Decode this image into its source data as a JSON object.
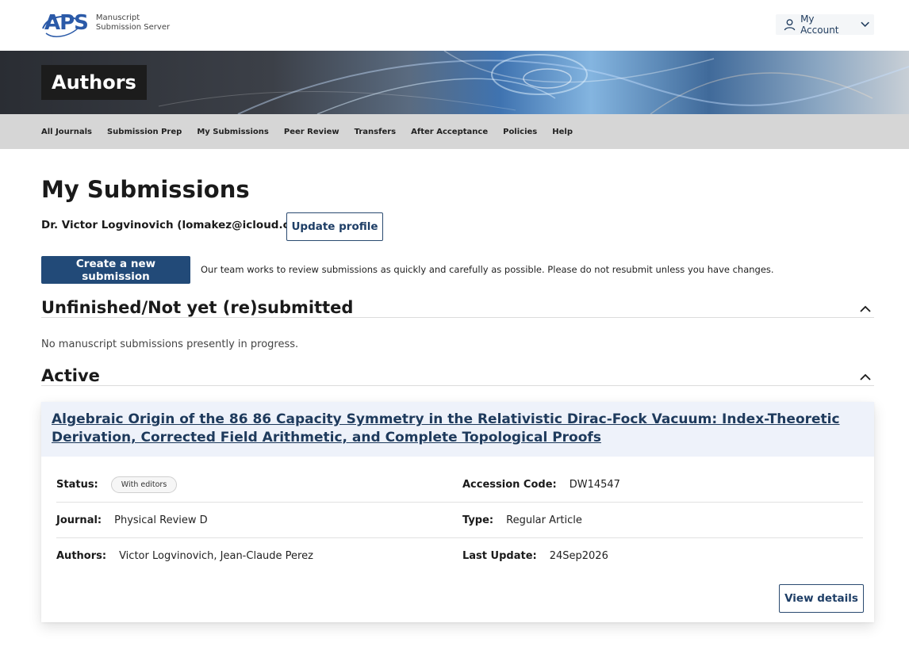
{
  "header": {
    "logo_text": "APS",
    "logo_subtitle_line1": "Manuscript",
    "logo_subtitle_line2": "Submission Server",
    "account_label": "My Account"
  },
  "banner": {
    "title": "Authors"
  },
  "nav": {
    "items": [
      "All Journals",
      "Submission Prep",
      "My Submissions",
      "Peer Review",
      "Transfers",
      "After Acceptance",
      "Policies",
      "Help"
    ]
  },
  "main": {
    "title": "My Submissions",
    "user": "Dr. Victor Logvinovich (lomakez@icloud.com)",
    "update_profile_label": "Update profile",
    "create_label": "Create a new submission",
    "notice": "Our team works to review submissions as quickly and carefully as possible. Please do not resubmit unless you have changes."
  },
  "sections": {
    "unfinished": {
      "title": "Unfinished/Not yet (re)submitted",
      "empty_message": "No manuscript submissions presently in progress."
    },
    "active": {
      "title": "Active"
    }
  },
  "submission": {
    "title": "Algebraic Origin of the 86 86 Capacity Symmetry in the Relativistic Dirac-Fock Vacuum: Index-Theoretic Derivation, Corrected Field Arithmetic, and Complete Topological Proofs",
    "status_label": "Status:",
    "status_value": "With editors",
    "accession_label": "Accession Code:",
    "accession_value": "DW14547",
    "journal_label": "Journal:",
    "journal_value": "Physical Review D",
    "type_label": "Type:",
    "type_value": "Regular Article",
    "authors_label": "Authors:",
    "authors_value": "Victor Logvinovich, Jean-Claude Perez",
    "last_update_label": "Last Update:",
    "last_update_value": "24Sep2026",
    "view_details_label": "View details"
  },
  "colors": {
    "brand_blue": "#224a78",
    "link_blue": "#1e3a5c",
    "nav_bg": "#d6d6d6",
    "card_head_bg": "#eef2fa"
  },
  "icons": {
    "account": "user-icon",
    "account_chevron": "chevron-down-icon",
    "section_toggle": "chevron-up-icon"
  }
}
